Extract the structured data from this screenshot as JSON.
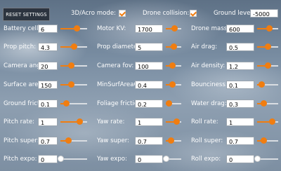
{
  "header": {
    "reset_label": "RESET SETTINGS",
    "acro_label": "3D/Acro mode:",
    "acro_checked": true,
    "collision_label": "Drone collision:",
    "collision_checked": true,
    "ground_label": "Ground level:",
    "ground_value": "-5000"
  },
  "accent_color": "#f07d10",
  "params": [
    {
      "label": "Battery cells:",
      "value": "6",
      "level": 0.6
    },
    {
      "label": "Motor KV:",
      "value": "1700",
      "level": 0.55
    },
    {
      "label": "Drone mass:",
      "value": "600",
      "level": 0.55
    },
    {
      "label": "Prop pitch:",
      "value": "4.3",
      "level": 0.5
    },
    {
      "label": "Prop diameter:",
      "value": "5",
      "level": 0.5
    },
    {
      "label": "Air drag:",
      "value": "0.5",
      "level": 0.5
    },
    {
      "label": "Camera angle:",
      "value": "20",
      "level": 0.4
    },
    {
      "label": "Camera fov:",
      "value": "100",
      "level": 0.4
    },
    {
      "label": "Air density:",
      "value": "1.2",
      "level": 0.5
    },
    {
      "label": "Surface area:",
      "value": "150",
      "level": 0.4
    },
    {
      "label": "MinSurfAreaCoeff:",
      "value": "0.4",
      "level": 0.4
    },
    {
      "label": "Bounciness:",
      "value": "0.1",
      "level": 0.2
    },
    {
      "label": "Ground friction:",
      "value": "0.1",
      "level": 0.2
    },
    {
      "label": "Foliage friction:",
      "value": "0.2",
      "level": 0.2
    },
    {
      "label": "Water drag:",
      "value": "0.3",
      "level": 0.3
    },
    {
      "label": "Pitch rate:",
      "value": "1",
      "level": 0.7
    },
    {
      "label": "Yaw rate:",
      "value": "1",
      "level": 0.7
    },
    {
      "label": "Roll rate:",
      "value": "1",
      "level": 0.7
    },
    {
      "label": "Pitch super:",
      "value": "0.7",
      "level": 0.3
    },
    {
      "label": "Yaw super:",
      "value": "0.7",
      "level": 0.3
    },
    {
      "label": "Roll super:",
      "value": "0.7",
      "level": 0.3
    },
    {
      "label": "Pitch expo:",
      "value": "0",
      "level": 0.0
    },
    {
      "label": "Yaw expo:",
      "value": "0",
      "level": 0.0
    },
    {
      "label": "Roll expo:",
      "value": "0",
      "level": 0.0
    }
  ]
}
